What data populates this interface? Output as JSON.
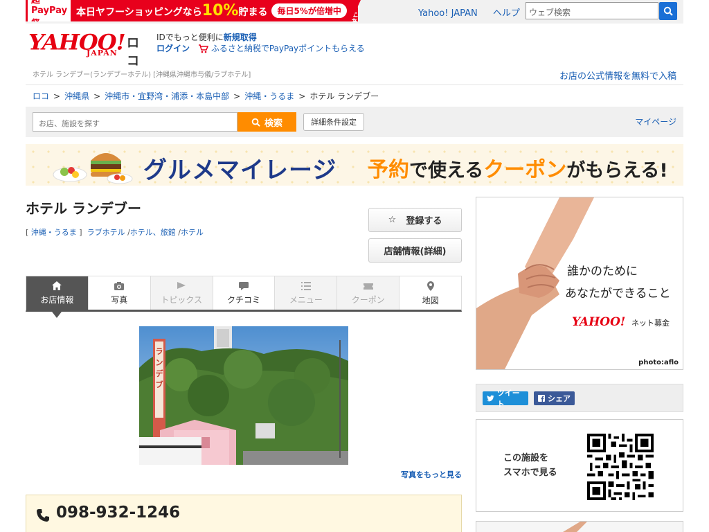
{
  "promo": {
    "logo": "超PayPay祭",
    "text_prefix": "本日ヤフーショッピングなら",
    "percent": "10%",
    "text_suffix": "貯まる",
    "pill": "毎日5%が倍増中",
    "note_line1": "※条件・",
    "note_line2": "上限あり"
  },
  "top_links": {
    "yahoo_japan": "Yahoo! JAPAN",
    "help": "ヘルプ"
  },
  "web_search": {
    "placeholder": "ウェブ検索"
  },
  "header": {
    "logo_main": "YAHOO!",
    "logo_sub": "JAPAN",
    "logo_service": "ロコ",
    "id_text": "IDでもっと便利に",
    "register_link": "新規取得",
    "login_link": "ログイン",
    "furusato": "ふるさと納税でPayPayポイントもらえる"
  },
  "meta": {
    "line": "ホテル ランデブー(ランデブーホテル) [沖縄県沖縄市与儀/ラブホテル]",
    "free_info": "お店の公式情報を無料で入稿"
  },
  "breadcrumb": {
    "items": [
      "ロコ",
      "沖縄県",
      "沖縄市・宜野湾・浦添・本島中部",
      "沖縄・うるま",
      "ホテル ランデブー"
    ],
    "sep": ">"
  },
  "shop_search": {
    "placeholder": "お店、施設を探す",
    "button": "検索",
    "advanced": "詳細条件設定",
    "mypage": "マイページ"
  },
  "banner": {
    "title": "グルメマイレージ",
    "part1": "予約",
    "part2": "で使える",
    "part3": "クーポン",
    "part4": "がもらえる!"
  },
  "shop": {
    "name": "ホテル ランデブー",
    "area": "沖縄・うるま",
    "cat1": "ラブホテル",
    "cat2": "ホテル、旅館",
    "cat3": "ホテル",
    "register": "登録する",
    "detail": "店舗情報(詳細)"
  },
  "tabs": [
    {
      "label": "お店情報",
      "icon": "home-icon",
      "state": "active"
    },
    {
      "label": "写真",
      "icon": "camera-icon",
      "state": "enabled"
    },
    {
      "label": "トピックス",
      "icon": "flag-icon",
      "state": "disabled"
    },
    {
      "label": "クチコミ",
      "icon": "speech-bubble-icon",
      "state": "enabled"
    },
    {
      "label": "メニュー",
      "icon": "list-icon",
      "state": "disabled"
    },
    {
      "label": "クーポン",
      "icon": "ticket-icon",
      "state": "disabled"
    },
    {
      "label": "地図",
      "icon": "map-pin-icon",
      "state": "enabled"
    }
  ],
  "photo": {
    "sign_text": "ランデブ",
    "more": "写真をもっと見る"
  },
  "phone": {
    "number": "098-932-1246"
  },
  "ad": {
    "copy1": "誰かのために",
    "copy2": "あなたができること",
    "logo": "YAHOO!",
    "logo_sub": "JAPAN",
    "service": "ネット募金",
    "credit": "photo:aflo"
  },
  "share": {
    "tweet": "ツイート",
    "facebook": "シェア"
  },
  "qr": {
    "line1": "この施設を",
    "line2": "スマホで見る"
  },
  "colors": {
    "accent": "#ff8c00",
    "link": "#1a5fb4",
    "brand_red": "#e60012",
    "tab_active": "#555555"
  }
}
